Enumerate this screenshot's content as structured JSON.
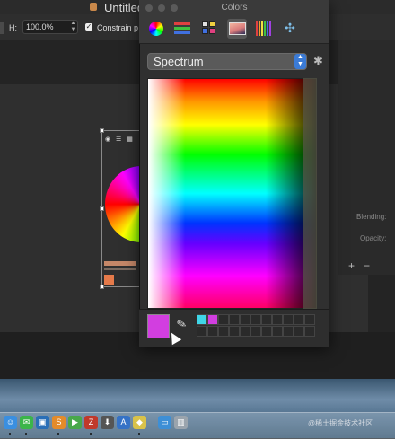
{
  "app": {
    "title": "Untitled"
  },
  "toolbar": {
    "h_label": "H:",
    "h_value": "100.0%",
    "constrain_label": "Constrain p",
    "constrain_checked": true
  },
  "right_panel": {
    "blending_label": "Blending:",
    "opacity_label": "Opacity:",
    "add_symbol": "+",
    "remove_symbol": "−"
  },
  "colors_window": {
    "title": "Colors",
    "tabs": [
      {
        "name": "color-wheel",
        "active": false
      },
      {
        "name": "color-sliders",
        "active": false
      },
      {
        "name": "color-palettes",
        "active": false
      },
      {
        "name": "image-palettes",
        "active": true
      },
      {
        "name": "pencils",
        "active": false
      },
      {
        "name": "extra-picker",
        "active": false
      }
    ],
    "mode_select": "Spectrum",
    "current_color": "#d23ee0",
    "swatches": [
      "#3fd6e8",
      "#d23ee0"
    ],
    "empty_swatch_count": 20
  },
  "watermark": "@稀土掘金技术社区",
  "colors": {
    "accent": "#3b7bd6",
    "window_bg": "#303030",
    "app_bg": "#242424"
  }
}
